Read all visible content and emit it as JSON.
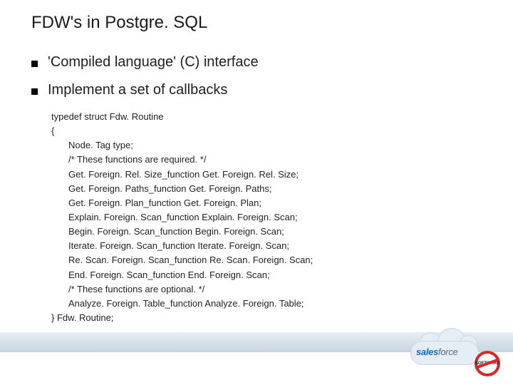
{
  "title": "FDW's in Postgre. SQL",
  "bullets": [
    "'Compiled language' (C) interface",
    "Implement a set of callbacks"
  ],
  "code": {
    "line1": "typedef struct Fdw. Routine",
    "open": "{",
    "body": [
      "Node. Tag      type;",
      "/* These functions are required. */",
      "Get. Foreign. Rel. Size_function Get. Foreign. Rel. Size;",
      "Get. Foreign. Paths_function Get. Foreign. Paths;",
      "Get. Foreign. Plan_function Get. Foreign. Plan;",
      "Explain. Foreign. Scan_function Explain. Foreign. Scan;",
      "Begin. Foreign. Scan_function Begin. Foreign. Scan;",
      "Iterate. Foreign. Scan_function Iterate. Foreign. Scan;",
      "Re. Scan. Foreign. Scan_function Re. Scan. Foreign. Scan;",
      "End. Foreign. Scan_function End. Foreign. Scan;",
      "/* These functions are optional. */",
      "Analyze. Foreign. Table_function Analyze. Foreign. Table;"
    ],
    "close": "} Fdw. Routine;"
  },
  "logo": {
    "sales": "sales",
    "force": "force",
    "badge": "SOFTWARE"
  }
}
